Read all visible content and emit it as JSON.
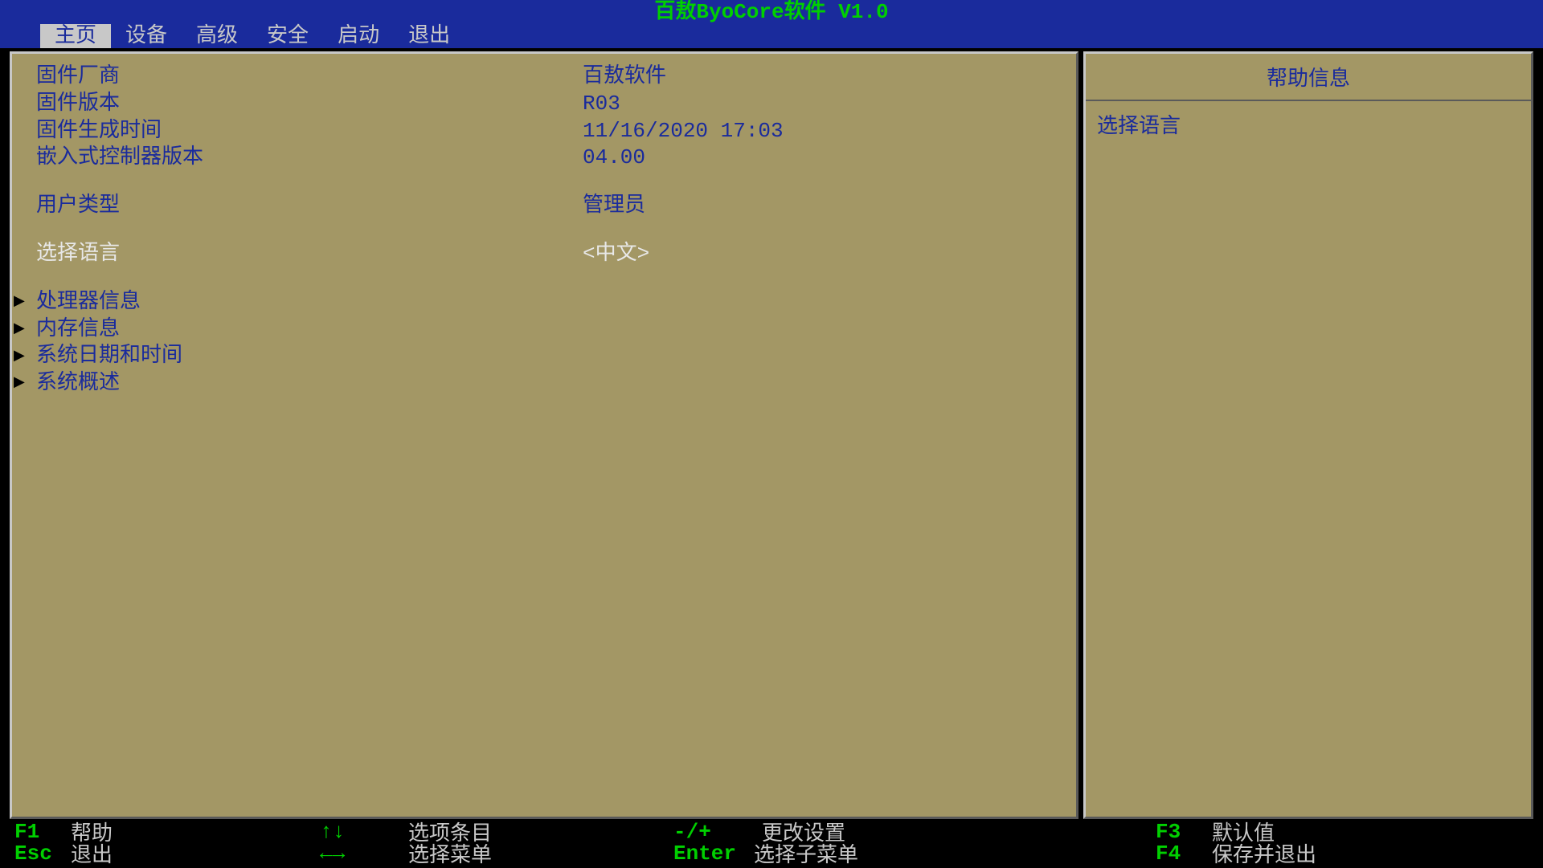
{
  "title": "百敖ByoCore软件 V1.0",
  "menu": [
    "主页",
    "设备",
    "高级",
    "安全",
    "启动",
    "退出"
  ],
  "active_menu_index": 0,
  "info_rows": [
    {
      "label": "固件厂商",
      "value": "百敖软件"
    },
    {
      "label": "固件版本",
      "value": "R03"
    },
    {
      "label": "固件生成时间",
      "value": "11/16/2020 17:03"
    },
    {
      "label": "嵌入式控制器版本",
      "value": "04.00"
    }
  ],
  "user_row": {
    "label": "用户类型",
    "value": "管理员"
  },
  "language_row": {
    "label": "选择语言",
    "value": "<中文>"
  },
  "submenus": [
    "处理器信息",
    "内存信息",
    "系统日期和时间",
    "系统概述"
  ],
  "help": {
    "title": "帮助信息",
    "body": "选择语言"
  },
  "footer": {
    "c1": [
      {
        "key": "F1",
        "label": "帮助"
      },
      {
        "key": "Esc",
        "label": "退出"
      }
    ],
    "c2": [
      {
        "sym": "↑↓",
        "label": "选项条目"
      },
      {
        "sym": "←→",
        "label": "选择菜单"
      }
    ],
    "c3": [
      {
        "sym": "-/+",
        "label": "更改设置"
      },
      {
        "key": "Enter",
        "label": "选择子菜单"
      }
    ],
    "c4": [
      {
        "key": "F3",
        "label": "默认值"
      },
      {
        "key": "F4",
        "label": "保存并退出"
      }
    ]
  }
}
